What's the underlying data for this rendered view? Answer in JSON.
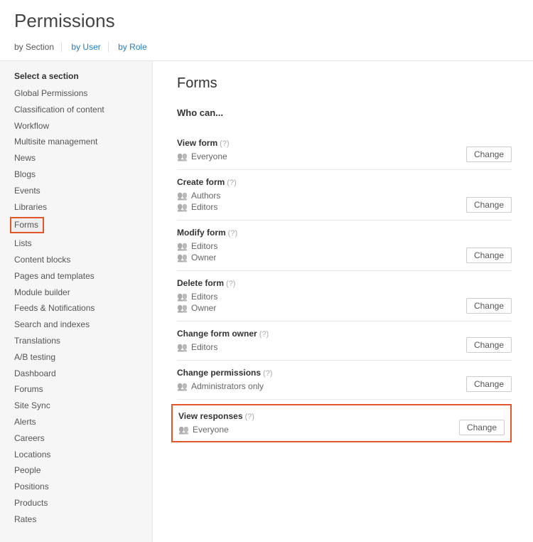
{
  "header": {
    "title": "Permissions",
    "tabs": [
      {
        "label": "by Section",
        "active": true
      },
      {
        "label": "by User",
        "active": false
      },
      {
        "label": "by Role",
        "active": false
      }
    ]
  },
  "sidebar": {
    "title": "Select a section",
    "items": [
      "Global Permissions",
      "Classification of content",
      "Workflow",
      "Multisite management",
      "News",
      "Blogs",
      "Events",
      "Libraries",
      "Forms",
      "Lists",
      "Content blocks",
      "Pages and templates",
      "Module builder",
      "Feeds & Notifications",
      "Search and indexes",
      "Translations",
      "A/B testing",
      "Dashboard",
      "Forums",
      "Site Sync",
      "Alerts",
      "Careers",
      "Locations",
      "People",
      "Positions",
      "Products",
      "Rates"
    ],
    "selected": "Forms"
  },
  "main": {
    "heading": "Forms",
    "subheading": "Who can...",
    "help": "(?)",
    "change_label": "Change",
    "permissions": [
      {
        "title": "View form",
        "roles": [
          "Everyone"
        ],
        "highlight": false
      },
      {
        "title": "Create form",
        "roles": [
          "Authors",
          "Editors"
        ],
        "highlight": false
      },
      {
        "title": "Modify form",
        "roles": [
          "Editors",
          "Owner"
        ],
        "highlight": false
      },
      {
        "title": "Delete form",
        "roles": [
          "Editors",
          "Owner"
        ],
        "highlight": false
      },
      {
        "title": "Change form owner",
        "roles": [
          "Editors"
        ],
        "highlight": false
      },
      {
        "title": "Change permissions",
        "roles": [
          "Administrators only"
        ],
        "highlight": false
      },
      {
        "title": "View responses",
        "roles": [
          "Everyone"
        ],
        "highlight": true
      }
    ]
  }
}
